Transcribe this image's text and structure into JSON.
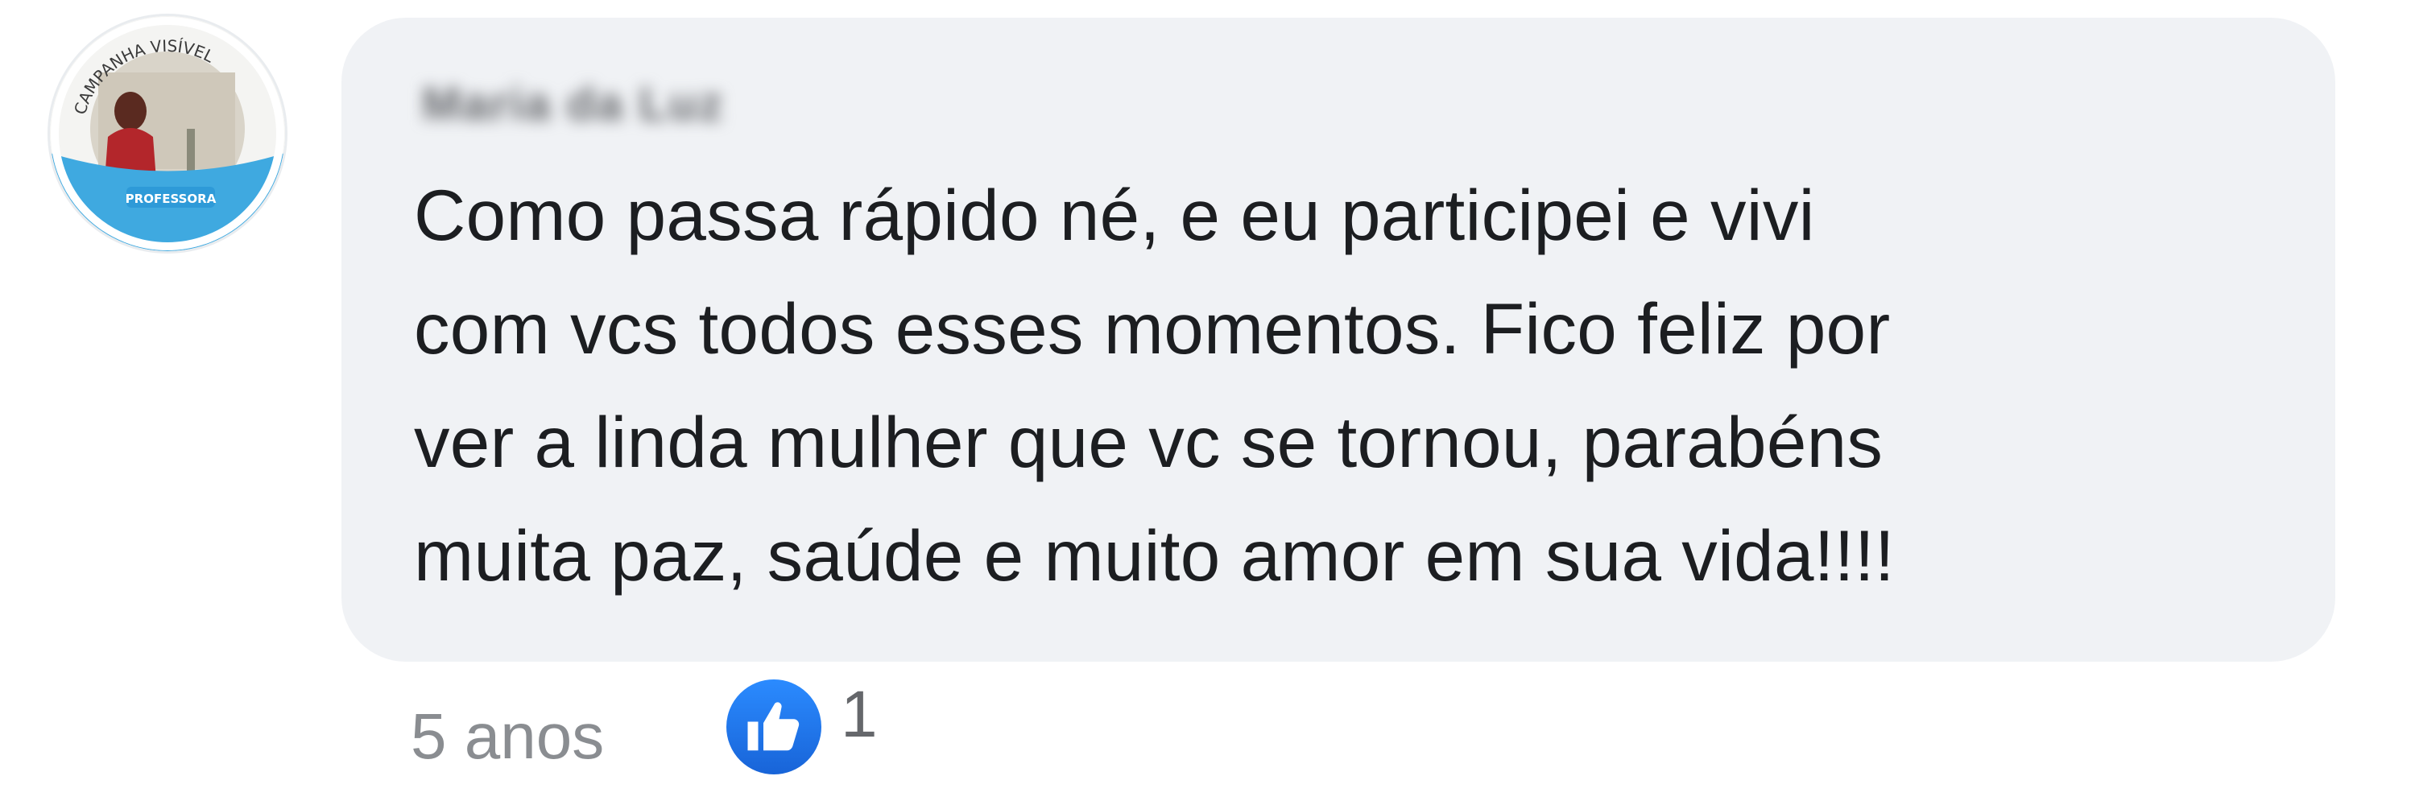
{
  "comment": {
    "author_name": "Maria da Luz",
    "text_lines": [
      "Como passa rápido né, e eu participei e vivi",
      "com vcs todos esses momentos. Fico feliz por",
      "ver a linda mulher que vc se tornou, parabéns",
      "muita paz, saúde e muito amor em sua vida!!!!"
    ],
    "timestamp": "5 anos",
    "reaction_count": "1",
    "reaction_icon": "like-icon"
  },
  "avatar": {
    "ring_text": "CAMPANHA VISÍVEL",
    "badge_text": "PROFESSORA",
    "ring_color": "#3fa9e0",
    "badge_color": "#2e9ad8"
  },
  "colors": {
    "bubble_bg": "#f0f2f5",
    "text": "#1c1e21",
    "meta_text": "#8a8d91",
    "like_blue": "#1877f2"
  }
}
